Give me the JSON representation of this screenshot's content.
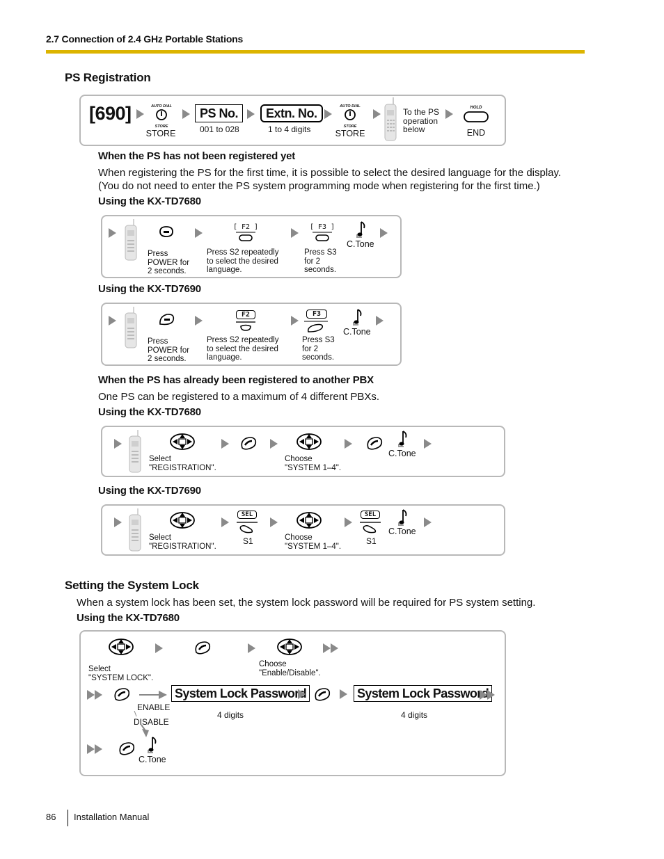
{
  "header": {
    "section_title": "2.7 Connection of 2.4 GHz Portable Stations",
    "accent_color": "#dcb400"
  },
  "ps_registration": {
    "title": "PS Registration",
    "flow": {
      "program_code": "[690]",
      "store_label_top": "AUTO DIAL",
      "store_label_bottom": "STORE",
      "store_caption": "STORE",
      "ps_no_key": "PS No.",
      "ps_no_caption": "001 to 028",
      "extn_no_key": "Extn. No.",
      "extn_no_caption": "1 to 4 digits",
      "store2_caption": "STORE",
      "ps_op_caption_1": "To the PS",
      "ps_op_caption_2": "operation",
      "ps_op_caption_3": "below",
      "hold_label": "HOLD",
      "end_caption": "END"
    },
    "not_registered": {
      "heading": "When the PS has not been registered yet",
      "text_1": "When registering the PS for the first time, it is possible to select the desired language for the display.",
      "text_2": "(You do not need to enter the PS system programming mode when registering for the first time.)",
      "td7680": {
        "heading": "Using the KX-TD7680",
        "power_caption": [
          "Press",
          "POWER for",
          "2 seconds."
        ],
        "f2_tag": "[ F2 ]",
        "f2_caption": [
          "Press S2 repeatedly",
          "to select the desired",
          "language."
        ],
        "f3_tag": "[ F3 ]",
        "f3_caption": [
          "Press S3",
          "for 2",
          "seconds."
        ],
        "ctone": "C.Tone"
      },
      "td7690": {
        "heading": "Using the KX-TD7690",
        "power_caption": [
          "Press",
          "POWER for",
          "2 seconds."
        ],
        "f2_tag": "F2",
        "f2_caption": [
          "Press S2 repeatedly",
          "to select the desired",
          "language."
        ],
        "f3_tag": "F3",
        "f3_caption": [
          "Press S3",
          "for 2",
          "seconds."
        ],
        "ctone": "C.Tone"
      }
    },
    "already_registered": {
      "heading": "When the PS has already been registered to another PBX",
      "text": "One PS can be registered to a maximum of 4 different PBXs.",
      "td7680": {
        "heading": "Using the KX-TD7680",
        "select_caption": [
          "Select",
          "\"REGISTRATION\"."
        ],
        "choose_caption": [
          "Choose",
          "\"SYSTEM 1–4\"."
        ],
        "ctone": "C.Tone"
      },
      "td7690": {
        "heading": "Using the KX-TD7690",
        "select_caption": [
          "Select",
          "\"REGISTRATION\"."
        ],
        "sel_tag": "SEL",
        "s1_caption": "S1",
        "choose_caption": [
          "Choose",
          "\"SYSTEM 1–4\"."
        ],
        "ctone": "C.Tone"
      }
    }
  },
  "system_lock": {
    "title": "Setting the System Lock",
    "text": "When a system lock has been set, the system lock password will be required for PS system setting.",
    "td7680": {
      "heading": "Using the KX-TD7680",
      "select_caption": [
        "Select",
        "\"SYSTEM LOCK\"."
      ],
      "choose_caption": [
        "Choose",
        "\"Enable/Disable\"."
      ],
      "password_key": "System Lock Password",
      "password_caption": "4 digits",
      "enable_label": "ENABLE",
      "disable_label": "DISABLE",
      "ctone": "C.Tone"
    }
  },
  "footer": {
    "page_number": "86",
    "manual_title": "Installation Manual"
  }
}
